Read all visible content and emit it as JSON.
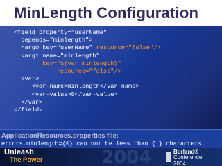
{
  "slide": {
    "title": "MinLength Configuration"
  },
  "code": {
    "line1": "<field property=\"userName\"",
    "line2": "  depends=\"minlength\">",
    "line3a": "  <arg0 key=\"userName\" ",
    "line3b": "resource=\"false\"/>",
    "line4": "  <arg1 name=\"minlength\"",
    "line5": "        key=\"${var:minlength}\"",
    "line6": "            resource=\"false\"/>",
    "line7": "  <var>",
    "line8": "     <var-name>minlength</var-name>",
    "line9": "     <var-value>5</var-value>",
    "line10": "  </var>",
    "line11": "</field>"
  },
  "resources": {
    "title": "ApplicationResources.properties file:",
    "line": "errors.minlength={0} can not be less than {1} characters."
  },
  "footer": {
    "unleash": "Unleash",
    "the": "The ",
    "power": "Power",
    "year": "2004",
    "brand": "Borland®",
    "conference": "Conference",
    "conf_year": "2004"
  },
  "colors": {
    "title": "#2b2b5e",
    "highlight": "#ff9a1e",
    "background": "#1c3a99"
  }
}
